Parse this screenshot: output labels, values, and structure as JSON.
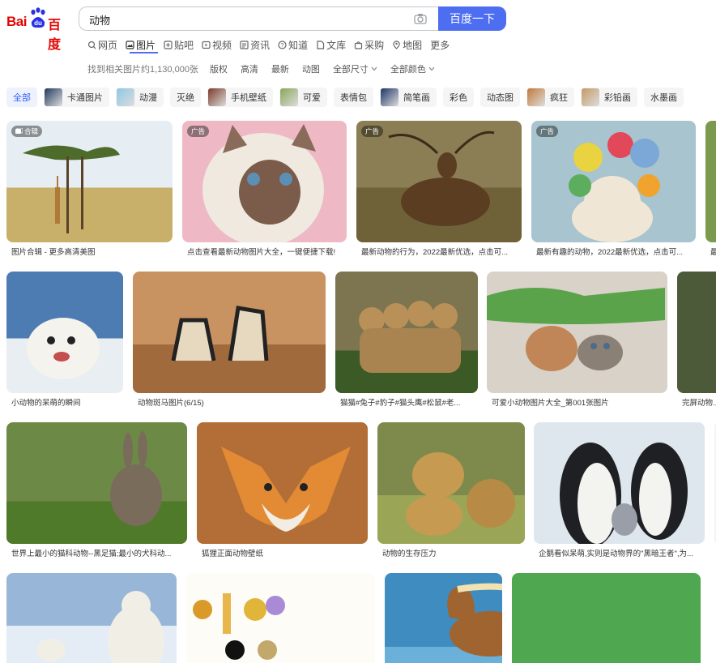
{
  "logo": {
    "left": "Bai",
    "paw": "du",
    "right": "百度"
  },
  "search": {
    "query": "动物",
    "button_label": "百度一下"
  },
  "nav": [
    {
      "label": "网页",
      "icon": "search-icon"
    },
    {
      "label": "图片",
      "icon": "picture-icon",
      "active": true
    },
    {
      "label": "贴吧",
      "icon": "tieba-icon"
    },
    {
      "label": "视频",
      "icon": "video-icon"
    },
    {
      "label": "资讯",
      "icon": "news-icon"
    },
    {
      "label": "知道",
      "icon": "question-icon"
    },
    {
      "label": "文库",
      "icon": "doc-icon"
    },
    {
      "label": "采购",
      "icon": "bag-icon"
    },
    {
      "label": "地图",
      "icon": "map-icon"
    },
    {
      "label": "更多",
      "icon": ""
    }
  ],
  "filter": {
    "count": "找到相关图片约1,130,000张",
    "items": [
      "版权",
      "高清",
      "最新",
      "动图"
    ],
    "dropdowns": [
      "全部尺寸",
      "全部颜色"
    ]
  },
  "tags": [
    {
      "label": "全部",
      "active": true
    },
    {
      "label": "卡通图片",
      "thumb": "#223a5e"
    },
    {
      "label": "动漫",
      "thumb": "#8fc6e6"
    },
    {
      "label": "灭绝"
    },
    {
      "label": "手机壁纸",
      "thumb": "#7a3b2a"
    },
    {
      "label": "可爱",
      "thumb": "#8aa65a"
    },
    {
      "label": "表情包"
    },
    {
      "label": "简笔画",
      "thumb": "#1d3566"
    },
    {
      "label": "彩色"
    },
    {
      "label": "动态图"
    },
    {
      "label": "疯狂",
      "thumb": "#c07a3a"
    },
    {
      "label": "彩铅画",
      "thumb": "#c39a66"
    },
    {
      "label": "水墨画"
    }
  ],
  "badges": {
    "collection": "合辑",
    "ad": "广告"
  },
  "results": [
    {
      "caption": "图片合辑 - 更多高清美图",
      "badge": "合辑"
    },
    {
      "caption": "点击查看最新动物图片大全，一键便捷下载!",
      "badge": "广告"
    },
    {
      "caption": "最新动物的行为，2022最新优选，点击可...",
      "badge": "广告"
    },
    {
      "caption": "最新有趣的动物，2022最新优选，点击可...",
      "badge": "广告"
    },
    {
      "caption": "最",
      "badge": ""
    },
    {
      "caption": "小动物的呆萌的瞬间"
    },
    {
      "caption": "动物斑马图片(6/15)"
    },
    {
      "caption": "猫猫#兔子#豹子#猫头鹰#松鼠#老..."
    },
    {
      "caption": "可爱小动物图片大全_第001张图片"
    },
    {
      "caption": "完屏动物..."
    },
    {
      "caption": "世界上最小的猫科动物--黑足猫;最小的犬科动..."
    },
    {
      "caption": "狐狸正面动物壁纸"
    },
    {
      "caption": "动物的生存压力"
    },
    {
      "caption": "企鹅看似呆萌,实则是动物界的\"黑暗王者\",为..."
    },
    {
      "caption": ""
    },
    {
      "caption": ""
    },
    {
      "caption": ""
    },
    {
      "caption": ""
    },
    {
      "caption": ""
    }
  ]
}
